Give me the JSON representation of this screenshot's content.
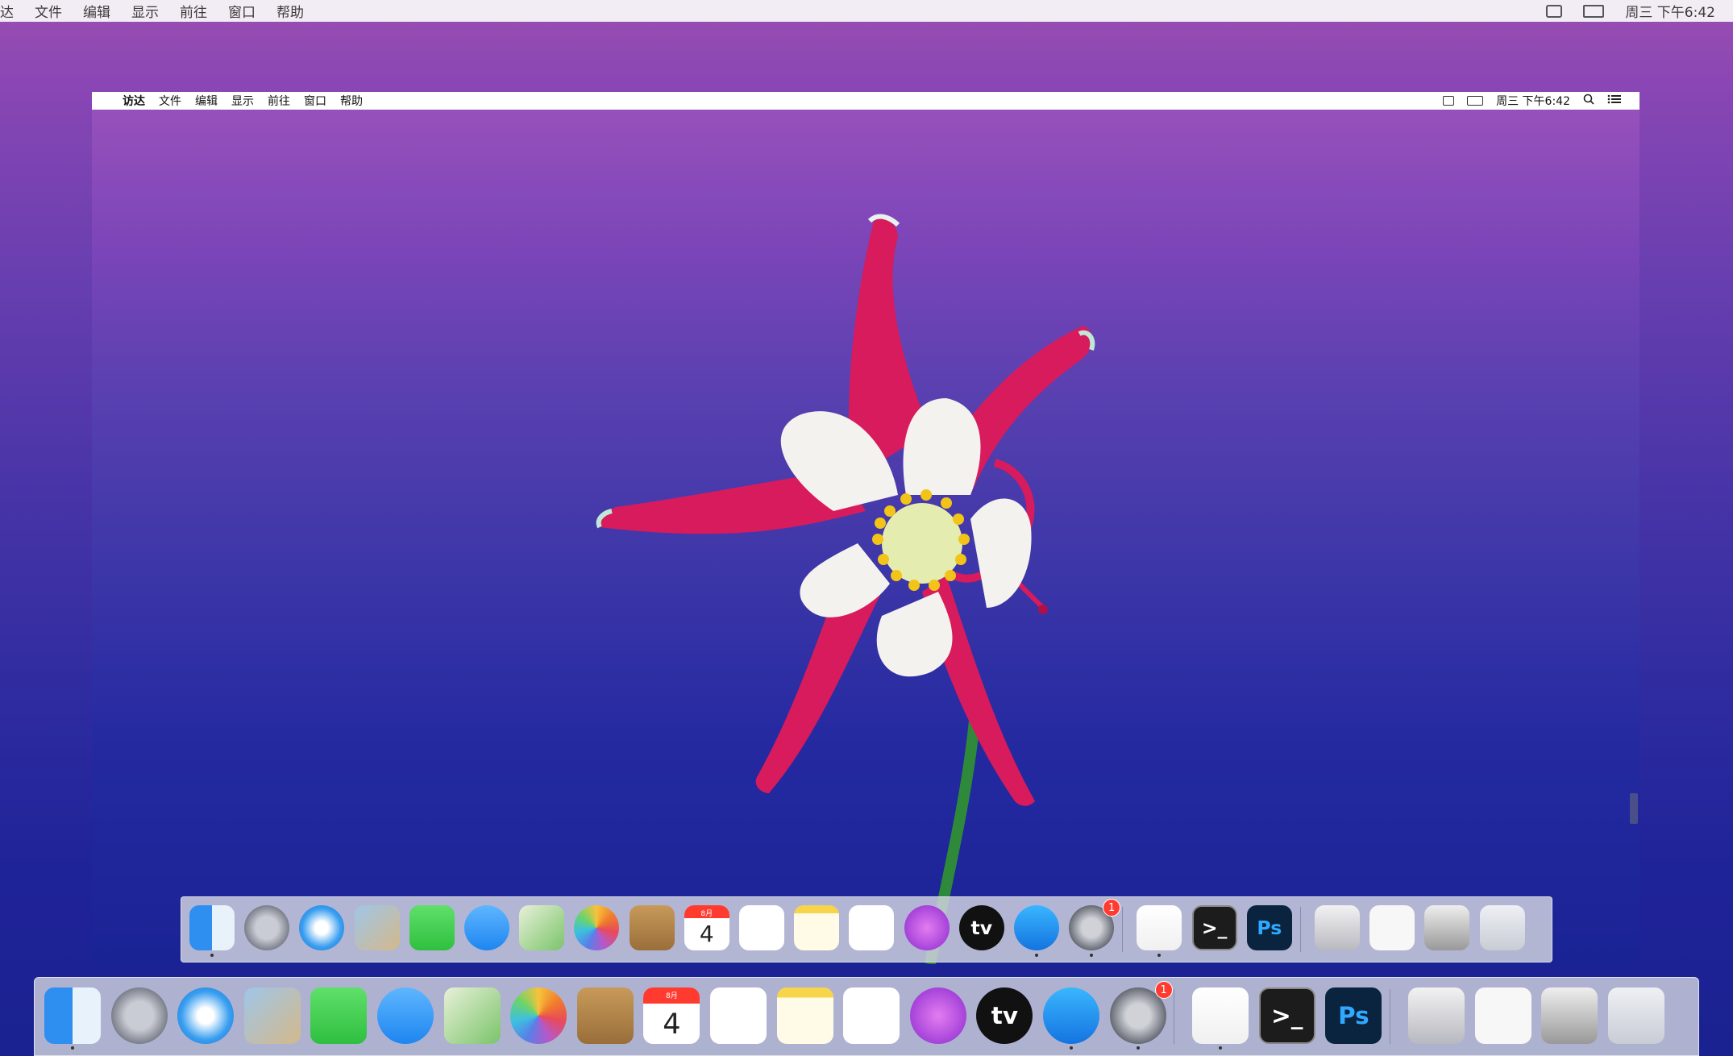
{
  "outer_menubar": {
    "app_fragment": "达",
    "items": [
      "文件",
      "编辑",
      "显示",
      "前往",
      "窗口",
      "帮助"
    ],
    "clock": "周三 下午6:42"
  },
  "inner_menubar": {
    "apple_glyph": "",
    "app_name": "访达",
    "items": [
      "文件",
      "编辑",
      "显示",
      "前往",
      "窗口",
      "帮助"
    ],
    "clock": "周三 下午6:42"
  },
  "dock": {
    "apps": [
      {
        "name": "finder-icon"
      },
      {
        "name": "launchpad-icon"
      },
      {
        "name": "safari-icon"
      },
      {
        "name": "mail-icon"
      },
      {
        "name": "facetime-icon"
      },
      {
        "name": "messages-icon"
      },
      {
        "name": "maps-icon"
      },
      {
        "name": "photos-icon"
      },
      {
        "name": "contacts-icon"
      },
      {
        "name": "calendar-icon",
        "month": "8月",
        "day": "4"
      },
      {
        "name": "reminders-icon"
      },
      {
        "name": "notes-icon"
      },
      {
        "name": "music-icon"
      },
      {
        "name": "podcasts-icon"
      },
      {
        "name": "apple-tv-icon",
        "label": "tv"
      },
      {
        "name": "app-store-icon"
      },
      {
        "name": "system-preferences-icon",
        "badge": "1"
      },
      {
        "name": "pages-icon"
      },
      {
        "name": "terminal-icon",
        "label": ">_"
      },
      {
        "name": "photoshop-icon",
        "label": "Ps"
      },
      {
        "name": "downloads-stack-icon"
      },
      {
        "name": "documents-stack-icon"
      },
      {
        "name": "screenshots-stack-icon"
      },
      {
        "name": "trash-icon"
      }
    ],
    "outer_badge": "1"
  },
  "colors": {
    "petal": "#d81b5c",
    "white_petal": "#f4f2ee",
    "stamen": "#f2c418",
    "stem": "#2e8a3a"
  }
}
